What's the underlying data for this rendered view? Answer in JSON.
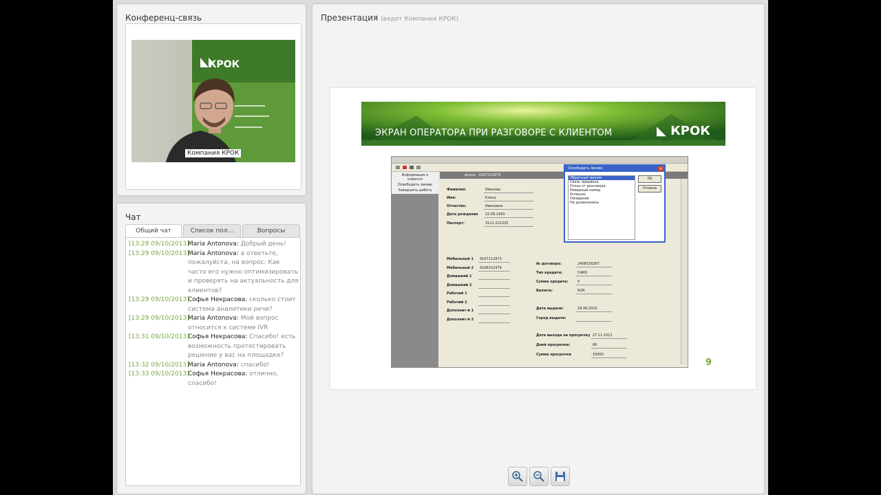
{
  "conference": {
    "title": "Конференц-связь",
    "video_label": "Компания КРОК",
    "backdrop_logo": "КРОК"
  },
  "chat": {
    "title": "Чат",
    "tabs": [
      "Общий чат",
      "Список пол...",
      "Вопросы"
    ],
    "active_tab": 0,
    "messages": [
      {
        "time": "[13:28 09/10/2013]",
        "author": "Maria Antonova:",
        "text": "Добрый день!"
      },
      {
        "time": "[13:29 09/10/2013]",
        "author": "Maria Antonova:",
        "text": "а ответьте, пожалуйста, на вопрос: Как часто его нужно оптимизировать и проверять на актуальность для клиентов?"
      },
      {
        "time": "[13:29 09/10/2013]",
        "author": "Софья Некрасова:",
        "text": "сколько стоит система аналитики речи?"
      },
      {
        "time": "[13:29 09/10/2013]",
        "author": "Maria Antonova:",
        "text": "Мой вопрос относится к системе IVR"
      },
      {
        "time": "[13:31 09/10/2013]",
        "author": "Софья Некрасова:",
        "text": "Спасибо! есть возможность протестировать решение у вас на площадке?"
      },
      {
        "time": "[13:32 09/10/2013]",
        "author": "Maria Antonova:",
        "text": "спасибо!"
      },
      {
        "time": "[13:33 09/10/2013]",
        "author": "Софья Некрасова:",
        "text": "отлично, спасибо!"
      }
    ]
  },
  "presentation": {
    "title": "Презентация",
    "subtitle": "(ведет Компания КРОК)",
    "slide": {
      "banner_title": "ЭКРАН ОПЕРАТОРА ПРИ РАЗГОВОРЕ С КЛИЕНТОМ",
      "logo": "КРОК",
      "page_number": "9",
      "screenshot": {
        "phone_header": "phone - 9167112973",
        "side_menu": [
          "Информация о клиенте",
          "Освободить линию",
          "Завершить работу"
        ],
        "fields_left": [
          {
            "label": "Фамилия:",
            "value": "Иванова"
          },
          {
            "label": "Имя:",
            "value": "Елена"
          },
          {
            "label": "Отчество:",
            "value": "Ивановна"
          },
          {
            "label": "Дата рождения",
            "value": "22.09.1950"
          },
          {
            "label": "Паспорт:",
            "value": "3111-222225"
          }
        ],
        "phones": [
          {
            "label": "Мобильный 1",
            "value": "9167112973"
          },
          {
            "label": "Мобильный 2",
            "value": "9166152479"
          },
          {
            "label": "Домашний 1",
            "value": ""
          },
          {
            "label": "Домашний 2",
            "value": ""
          },
          {
            "label": "Рабочий 1",
            "value": ""
          },
          {
            "label": "Рабочий 2",
            "value": ""
          },
          {
            "label": "Дополнит-й 1",
            "value": ""
          },
          {
            "label": "Дополнит-й 2",
            "value": ""
          }
        ],
        "fields_right": [
          {
            "label": "№ договора:",
            "value": "2408516267"
          },
          {
            "label": "Тип кредита:",
            "value": "CARD"
          },
          {
            "label": "Сумма кредита:",
            "value": "0"
          },
          {
            "label": "Валюта:",
            "value": "RUR"
          },
          {
            "label": "Дата выдачи:",
            "value": "18.06.2010"
          },
          {
            "label": "Город выдачи:",
            "value": ""
          },
          {
            "label": "Дата выхода на просрочку",
            "value": "27.11.2011"
          },
          {
            "label": "Дней просрочки:",
            "value": "66"
          },
          {
            "label": "Сумма просрочки",
            "value": "10000"
          }
        ],
        "dialog": {
          "title": "Освободить линию",
          "ok": "Ok",
          "cancel": "Отмена",
          "options": [
            "Обратный звонок",
            "Связь прервана",
            "Отказ от разговора",
            "Неверный номер",
            "Успешно",
            "Ожидание",
            "Не дозвонились"
          ]
        }
      }
    },
    "toolbar": {
      "zoom_in_icon": "zoom-in-icon",
      "zoom_out_icon": "zoom-out-icon",
      "save_icon": "save-icon"
    }
  }
}
